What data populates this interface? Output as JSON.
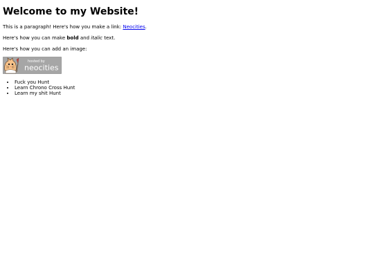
{
  "heading": "Welcome to my Website!",
  "paragraph1": {
    "prefix": "This is a paragraph! Here's how you make a link:",
    "link_text": "Neocities",
    "suffix": "."
  },
  "paragraph2": {
    "prefix": "Here's how you can make",
    "bold": "bold",
    "middle": "and",
    "italic": "italic",
    "suffix": "text."
  },
  "paragraph3": "Here's how you can add an image:",
  "badge": {
    "line1": "hosted by",
    "line2": "neocities",
    "bg_color": "#a6a6a6",
    "text_color": "#ffffff"
  },
  "list_items": [
    "Fuck you Hunt",
    "Learn Chrono Cross Hunt",
    "Learn my shit Hunt"
  ],
  "colors": {
    "link": "#0000ee"
  }
}
